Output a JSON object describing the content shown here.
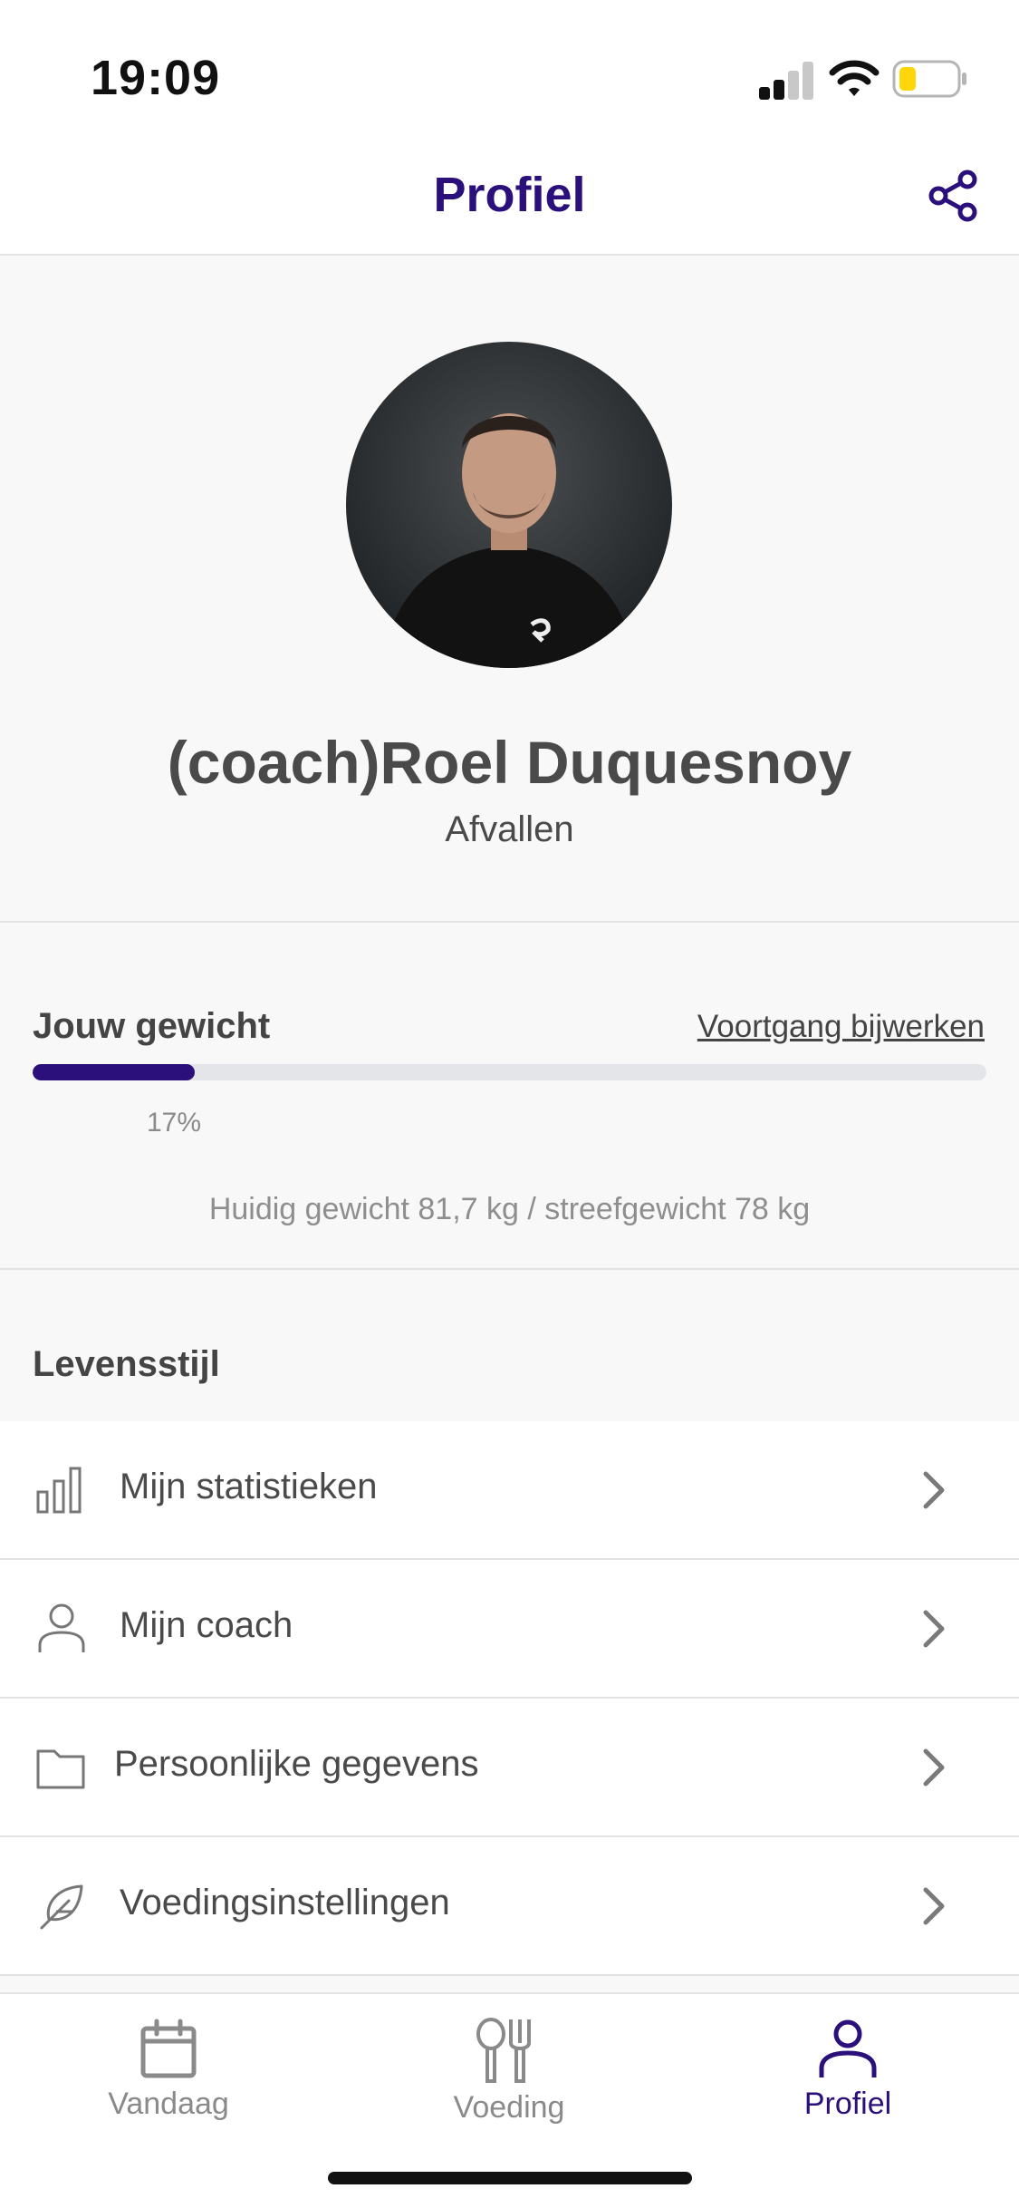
{
  "status_bar": {
    "time": "19:09",
    "icons": [
      "cellular-signal-icon",
      "wifi-icon",
      "battery-low-icon"
    ]
  },
  "header": {
    "title": "Profiel",
    "share_icon": "share-icon"
  },
  "profile": {
    "name": "(coach)Roel Duquesnoy",
    "goal": "Afvallen"
  },
  "weight": {
    "title": "Jouw gewicht",
    "update_link": "Voortgang bijwerken",
    "progress_percent": 17,
    "progress_label": "17%",
    "detail": "Huidig gewicht 81,7 kg / streefgewicht 78 kg"
  },
  "lifestyle": {
    "title": "Levensstijl",
    "items": [
      {
        "label": "Mijn statistieken",
        "icon": "bar-chart-icon"
      },
      {
        "label": "Mijn coach",
        "icon": "person-icon"
      },
      {
        "label": "Persoonlijke gegevens",
        "icon": "folder-icon"
      },
      {
        "label": "Voedingsinstellingen",
        "icon": "feather-icon"
      }
    ]
  },
  "tabs": [
    {
      "label": "Vandaag",
      "icon": "calendar-icon",
      "active": false
    },
    {
      "label": "Voeding",
      "icon": "cutlery-icon",
      "active": false
    },
    {
      "label": "Profiel",
      "icon": "person-icon",
      "active": true
    }
  ],
  "colors": {
    "accent": "#2b0f7a",
    "text": "#4a4a4a",
    "muted": "#8a8a8a",
    "battery": "#ffd60a"
  }
}
